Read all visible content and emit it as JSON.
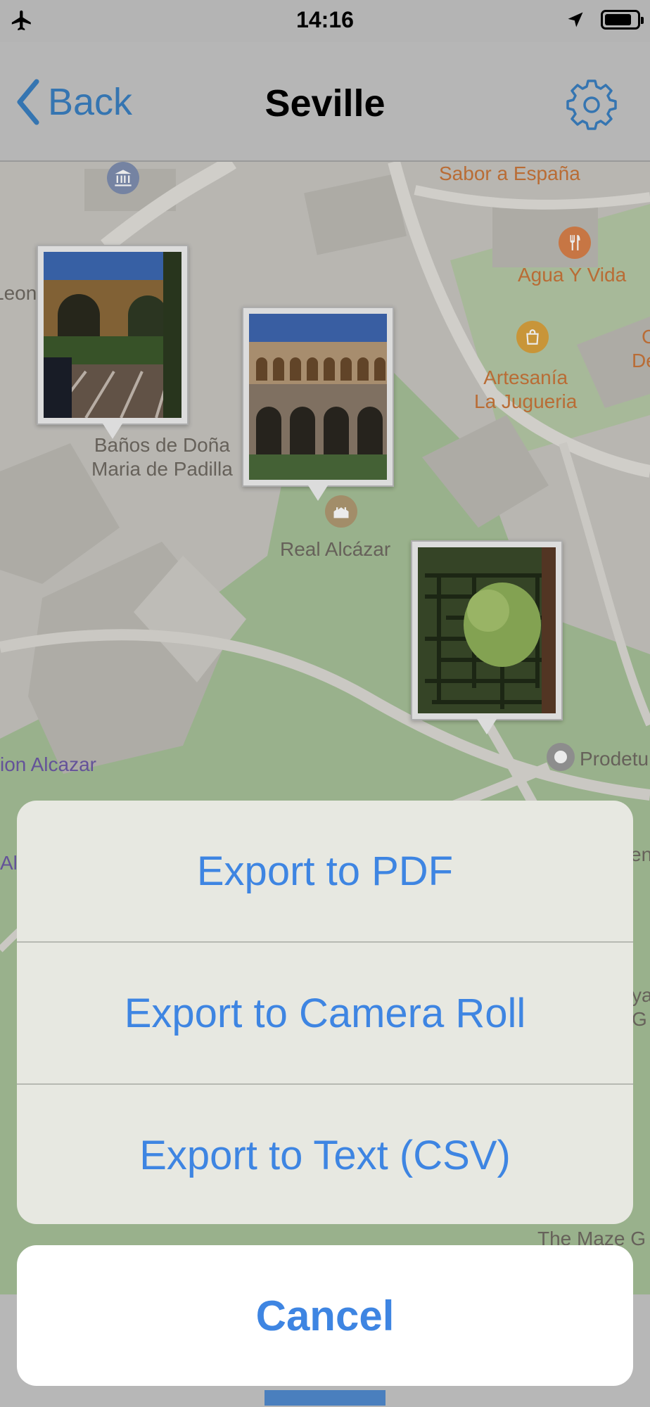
{
  "status_bar": {
    "time": "14:16"
  },
  "nav": {
    "back_label": "Back",
    "title": "Seville"
  },
  "map": {
    "labels": {
      "sabor": "Sabor a España",
      "agua": "Agua Y Vida",
      "artesania": "Artesanía\nLa Jugueria",
      "banos": "Baños de Doña\nMaria de Padilla",
      "alcazar": "Real Alcázar",
      "leon": "Leon",
      "ion_alcazar": "ion Alcazar",
      "prodetu": "Prodetu",
      "maze": "The Maze G",
      "al": "Al",
      "en": "en",
      "ya": "ya",
      "g": "G",
      "c": "C",
      "de": "De"
    }
  },
  "sheet": {
    "items": [
      "Export to PDF",
      "Export to Camera Roll",
      "Export to Text (CSV)"
    ],
    "cancel": "Cancel"
  },
  "colors": {
    "accent": "#3e85e2",
    "nav_blue": "#3a7fc0"
  }
}
